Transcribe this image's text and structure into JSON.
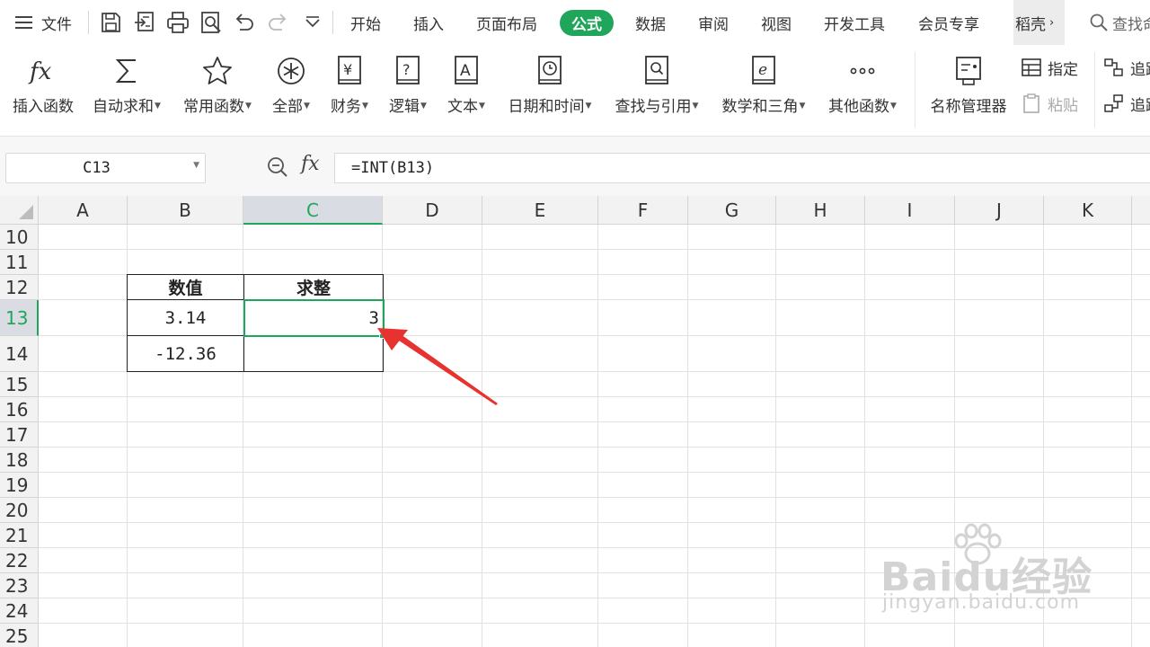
{
  "toolbar": {
    "menu_label": "文件",
    "tabs": [
      "开始",
      "插入",
      "页面布局",
      "公式",
      "数据",
      "审阅",
      "视图",
      "开发工具",
      "会员专享",
      "稻壳"
    ],
    "active_tab": "公式",
    "search_label": "查找命"
  },
  "ribbon": {
    "buttons": [
      {
        "label": "插入函数",
        "icon": "fx-icon"
      },
      {
        "label": "自动求和",
        "icon": "sigma-icon"
      },
      {
        "label": "常用函数",
        "icon": "star-icon"
      },
      {
        "label": "全部",
        "icon": "asterisk-circle-icon"
      },
      {
        "label": "财务",
        "icon": "yen-book-icon"
      },
      {
        "label": "逻辑",
        "icon": "question-book-icon"
      },
      {
        "label": "文本",
        "icon": "text-book-icon"
      },
      {
        "label": "日期和时间",
        "icon": "clock-book-icon"
      },
      {
        "label": "查找与引用",
        "icon": "search-book-icon"
      },
      {
        "label": "数学和三角",
        "icon": "theta-book-icon"
      },
      {
        "label": "其他函数",
        "icon": "more-dots-icon"
      },
      {
        "label": "名称管理器",
        "icon": "name-manager-icon"
      }
    ],
    "assign_label": "指定",
    "paste_label": "粘贴",
    "trace_label_1": "追踪",
    "trace_label_2": "追踪"
  },
  "formula_bar": {
    "name_box": "C13",
    "fx_label": "fx",
    "formula": "=INT(B13)"
  },
  "sheet": {
    "columns": [
      "A",
      "B",
      "C",
      "D",
      "E",
      "F",
      "G",
      "H",
      "I",
      "J",
      "K"
    ],
    "selected_column": "C",
    "rows": [
      "10",
      "11",
      "12",
      "13",
      "14",
      "15",
      "16",
      "17",
      "18",
      "19",
      "20",
      "21",
      "22",
      "23",
      "24",
      "25"
    ],
    "selected_row": "13",
    "table": {
      "header_value": "数值",
      "header_int": "求整",
      "b13": "3.14",
      "c13": "3",
      "b14": "-12.36",
      "c14": ""
    },
    "active_cell": "C13"
  },
  "watermark": {
    "main": "Baidu经验",
    "sub": "jingyan.baidu.com"
  },
  "colors": {
    "accent": "#1fa65a",
    "arrow": "#e8322f"
  }
}
